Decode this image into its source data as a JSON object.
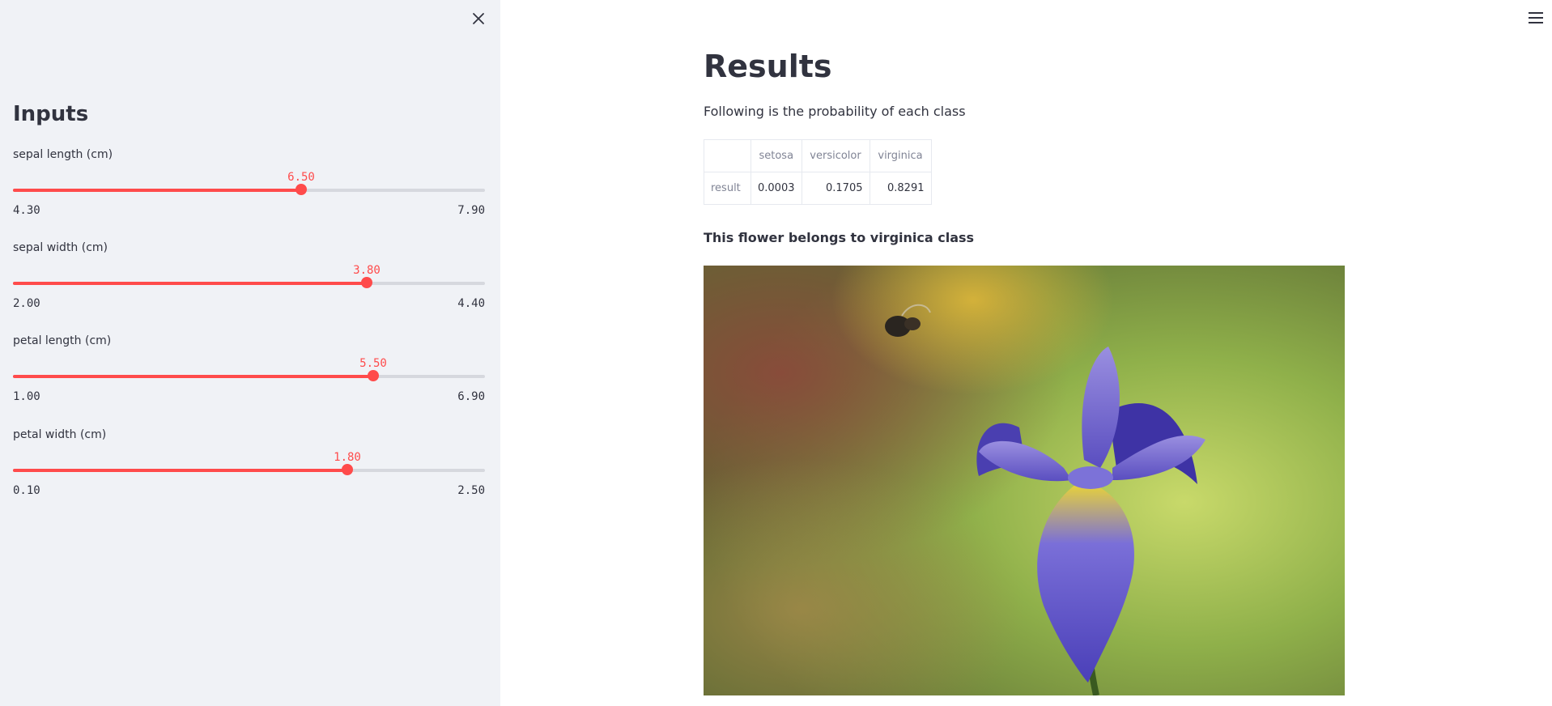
{
  "sidebar": {
    "title": "Inputs",
    "close_icon": "close-icon",
    "sliders": [
      {
        "label": "sepal length (cm)",
        "value": "6.50",
        "min": "4.30",
        "max": "7.90",
        "fraction": 0.611
      },
      {
        "label": "sepal width (cm)",
        "value": "3.80",
        "min": "2.00",
        "max": "4.40",
        "fraction": 0.75
      },
      {
        "label": "petal length (cm)",
        "value": "5.50",
        "min": "1.00",
        "max": "6.90",
        "fraction": 0.763
      },
      {
        "label": "petal width (cm)",
        "value": "1.80",
        "min": "0.10",
        "max": "2.50",
        "fraction": 0.708
      }
    ]
  },
  "main": {
    "menu_icon": "hamburger-menu-icon",
    "title": "Results",
    "subtitle": "Following is the probability of each class",
    "table": {
      "headers": [
        "setosa",
        "versicolor",
        "virginica"
      ],
      "row_label": "result",
      "values": [
        "0.0003",
        "0.1705",
        "0.8291"
      ]
    },
    "prediction": "This flower belongs to virginica class",
    "image_subject": "iris-flower-with-bee"
  },
  "colors": {
    "accent": "#ff4b4b",
    "sidebar_bg": "#f0f2f6",
    "text": "#31333f",
    "muted": "#808495"
  }
}
